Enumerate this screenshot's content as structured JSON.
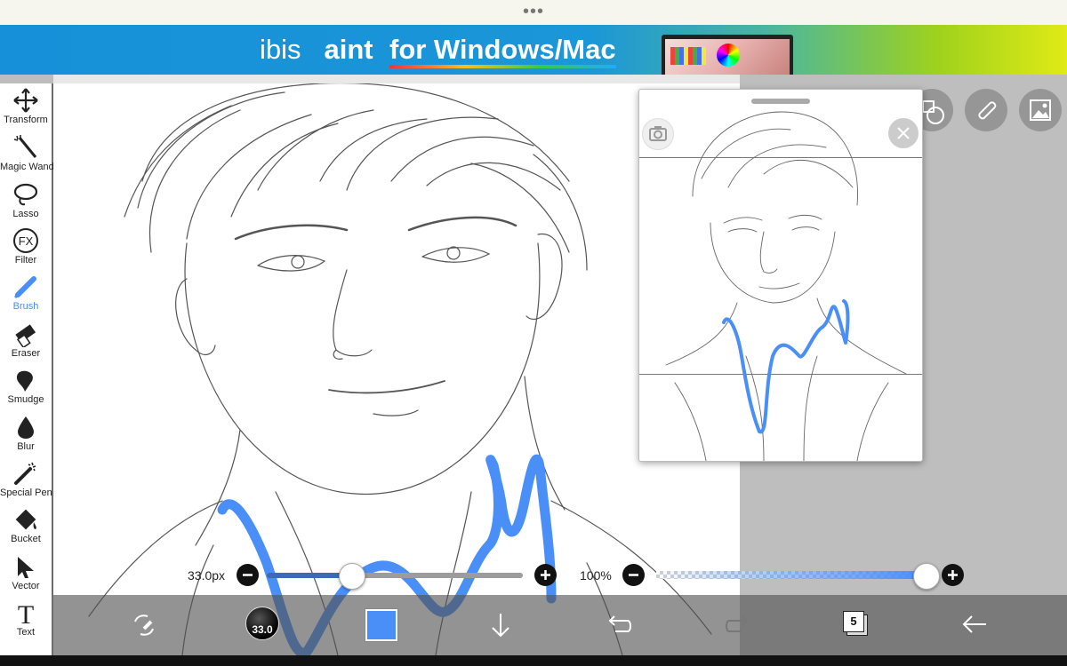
{
  "top_handle": {
    "dots": "•••"
  },
  "banner": {
    "logo_prefix": "ibis",
    "logo_suffix": "aint",
    "tagline": "for Windows/Mac"
  },
  "tools": [
    {
      "label": "Transform",
      "icon": "transform-move-icon"
    },
    {
      "label": "Magic Wand",
      "icon": "magic-wand-icon"
    },
    {
      "label": "Lasso",
      "icon": "lasso-icon"
    },
    {
      "label": "Filter",
      "icon": "fx-filter-icon",
      "glyph": "FX"
    },
    {
      "label": "Brush",
      "icon": "brush-icon",
      "active": true
    },
    {
      "label": "Eraser",
      "icon": "eraser-icon"
    },
    {
      "label": "Smudge",
      "icon": "smudge-icon"
    },
    {
      "label": "Blur",
      "icon": "blur-drop-icon"
    },
    {
      "label": "Special Pen",
      "icon": "special-pen-icon"
    },
    {
      "label": "Bucket",
      "icon": "bucket-icon"
    },
    {
      "label": "Vector",
      "icon": "vector-arrow-icon"
    },
    {
      "label": "Text",
      "icon": "text-icon",
      "glyph": "T"
    }
  ],
  "brush_slider": {
    "value_label": "33.0px",
    "value": 33.0,
    "fill": 0.33
  },
  "opacity_slider": {
    "value_label": "100%",
    "value": 100
  },
  "bottom_bar": {
    "brush_size_label": "33.0",
    "color_hex": "#4a8ef7",
    "layer_count": "5"
  },
  "colors": {
    "accent": "#4a8ef7",
    "stroke": "#4a8ef7"
  }
}
